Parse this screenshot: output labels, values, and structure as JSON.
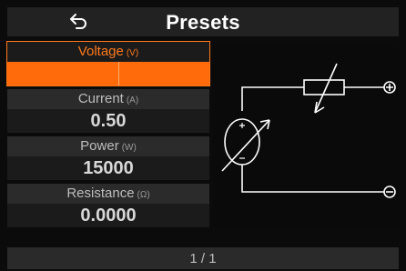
{
  "header": {
    "title": "Presets",
    "back_icon": "back-arrow-icon"
  },
  "params": [
    {
      "label": "Voltage",
      "unit": "(V)",
      "value": "",
      "active": true
    },
    {
      "label": "Current",
      "unit": "(A)",
      "value": "0.50"
    },
    {
      "label": "Power",
      "unit": "(W)",
      "value": "15000"
    },
    {
      "label": "Resistance",
      "unit": "(Ω)",
      "value": "0.0000"
    }
  ],
  "diagram": {
    "positive_terminal": "+",
    "negative_terminal": "−"
  },
  "footer": {
    "page_indicator": "1 / 1"
  },
  "colors": {
    "accent": "#ff6a0a",
    "background": "#0b0b0b",
    "panel": "#1b1b1b"
  }
}
